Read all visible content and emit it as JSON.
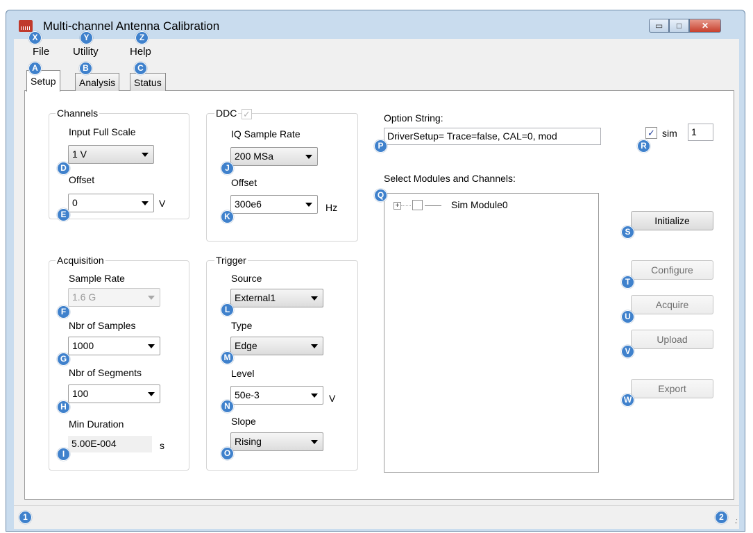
{
  "window": {
    "title": "Multi-channel Antenna Calibration",
    "minimize_glyph": "▭",
    "maximize_glyph": "□",
    "close_glyph": "✕"
  },
  "menu": {
    "items": [
      {
        "label": "File"
      },
      {
        "label": "Utility"
      },
      {
        "label": "Help"
      }
    ]
  },
  "tabs": [
    {
      "label": "Setup",
      "active": true
    },
    {
      "label": "Analysis"
    },
    {
      "label": "Status"
    }
  ],
  "channels": {
    "title": "Channels",
    "input_full_scale_label": "Input Full Scale",
    "input_full_scale_value": "1 V",
    "offset_label": "Offset",
    "offset_value": "0",
    "offset_unit": "V"
  },
  "ddc": {
    "title": "DDC",
    "enabled_check": "✓",
    "iq_sample_rate_label": "IQ Sample Rate",
    "iq_sample_rate_value": "200 MSa",
    "offset_label": "Offset",
    "offset_value": "300e6",
    "offset_unit": "Hz"
  },
  "acquisition": {
    "title": "Acquisition",
    "sample_rate_label": "Sample Rate",
    "sample_rate_value": "1.6 G",
    "nbr_samples_label": "Nbr of Samples",
    "nbr_samples_value": "1000",
    "nbr_segments_label": "Nbr of Segments",
    "nbr_segments_value": "100",
    "min_duration_label": "Min Duration",
    "min_duration_value": "5.00E-004",
    "min_duration_unit": "s"
  },
  "trigger": {
    "title": "Trigger",
    "source_label": "Source",
    "source_value": "External1",
    "type_label": "Type",
    "type_value": "Edge",
    "level_label": "Level",
    "level_value": "50e-3",
    "level_unit": "V",
    "slope_label": "Slope",
    "slope_value": "Rising"
  },
  "options": {
    "option_string_label": "Option String:",
    "option_string_value": "DriverSetup= Trace=false, CAL=0, mod",
    "sim_check": "✓",
    "sim_label": "sim",
    "sim_value": "1",
    "modules_label": "Select Modules and Channels:",
    "tree_expander": "+",
    "tree_module": "Sim Module0"
  },
  "buttons": {
    "initialize": "Initialize",
    "configure": "Configure",
    "acquire": "Acquire",
    "upload": "Upload",
    "export": "Export"
  },
  "status_bar": {
    "grip": ".:"
  },
  "markers": {
    "x": "X",
    "y": "Y",
    "z": "Z",
    "a": "A",
    "b": "B",
    "c": "C",
    "d": "D",
    "e": "E",
    "f": "F",
    "g": "G",
    "h": "H",
    "i": "I",
    "j": "J",
    "k": "K",
    "l": "L",
    "m": "M",
    "n": "N",
    "o": "O",
    "p": "P",
    "q": "Q",
    "r": "R",
    "s": "S",
    "t": "T",
    "u": "U",
    "v": "V",
    "w": "W",
    "one": "1",
    "two": "2"
  },
  "colors": {
    "marker": "#3f81cc",
    "close_button": "#c7402d",
    "window_frame": "#c9dcee",
    "app_icon": "#c0392b"
  }
}
